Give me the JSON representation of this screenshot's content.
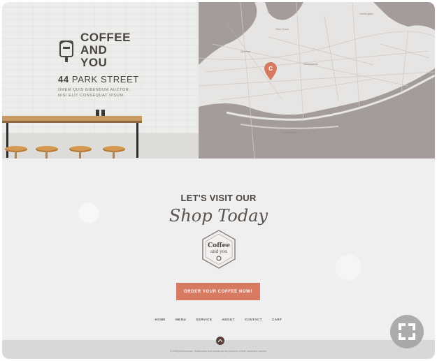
{
  "hero": {
    "brand": "COFFEE AND YOU",
    "brand_line1": "COFFEE",
    "brand_line2": "AND",
    "brand_line3": "YOU",
    "address_number": "44",
    "address_street": "PARK STREET",
    "tagline_line1": "OREM QUIS BIBENDUM AUCTOR,",
    "tagline_line2": "NISI ELIT CONSEQUAT IPSUM."
  },
  "map": {
    "pin_label": "C",
    "labels": [
      "Huntington",
      "Hempstead",
      "Long Beach",
      "Glen Cove",
      "Queens"
    ]
  },
  "middle": {
    "heading": "LET'S VISIT OUR",
    "script": "Shop Today",
    "badge_line1": "Coffee",
    "badge_line2": "and you",
    "cta_label": "ORDER YOUR COFFEE NOW!"
  },
  "nav": {
    "items": [
      "HOME",
      "MENU",
      "SERVICE",
      "ABOUT",
      "CONTACT",
      "CART"
    ]
  },
  "footer": {
    "copyright": "© 2015 jabresources. Trademarks and brands are the property of their respective owners."
  },
  "colors": {
    "accent": "#d67b61",
    "brand_text": "#4a4440",
    "map_water": "#a39c9a",
    "footer_bg": "#d8d8d8"
  },
  "icons": [
    "mailbox-icon",
    "map-pin-icon",
    "scroll-up-icon",
    "expand-icon"
  ]
}
